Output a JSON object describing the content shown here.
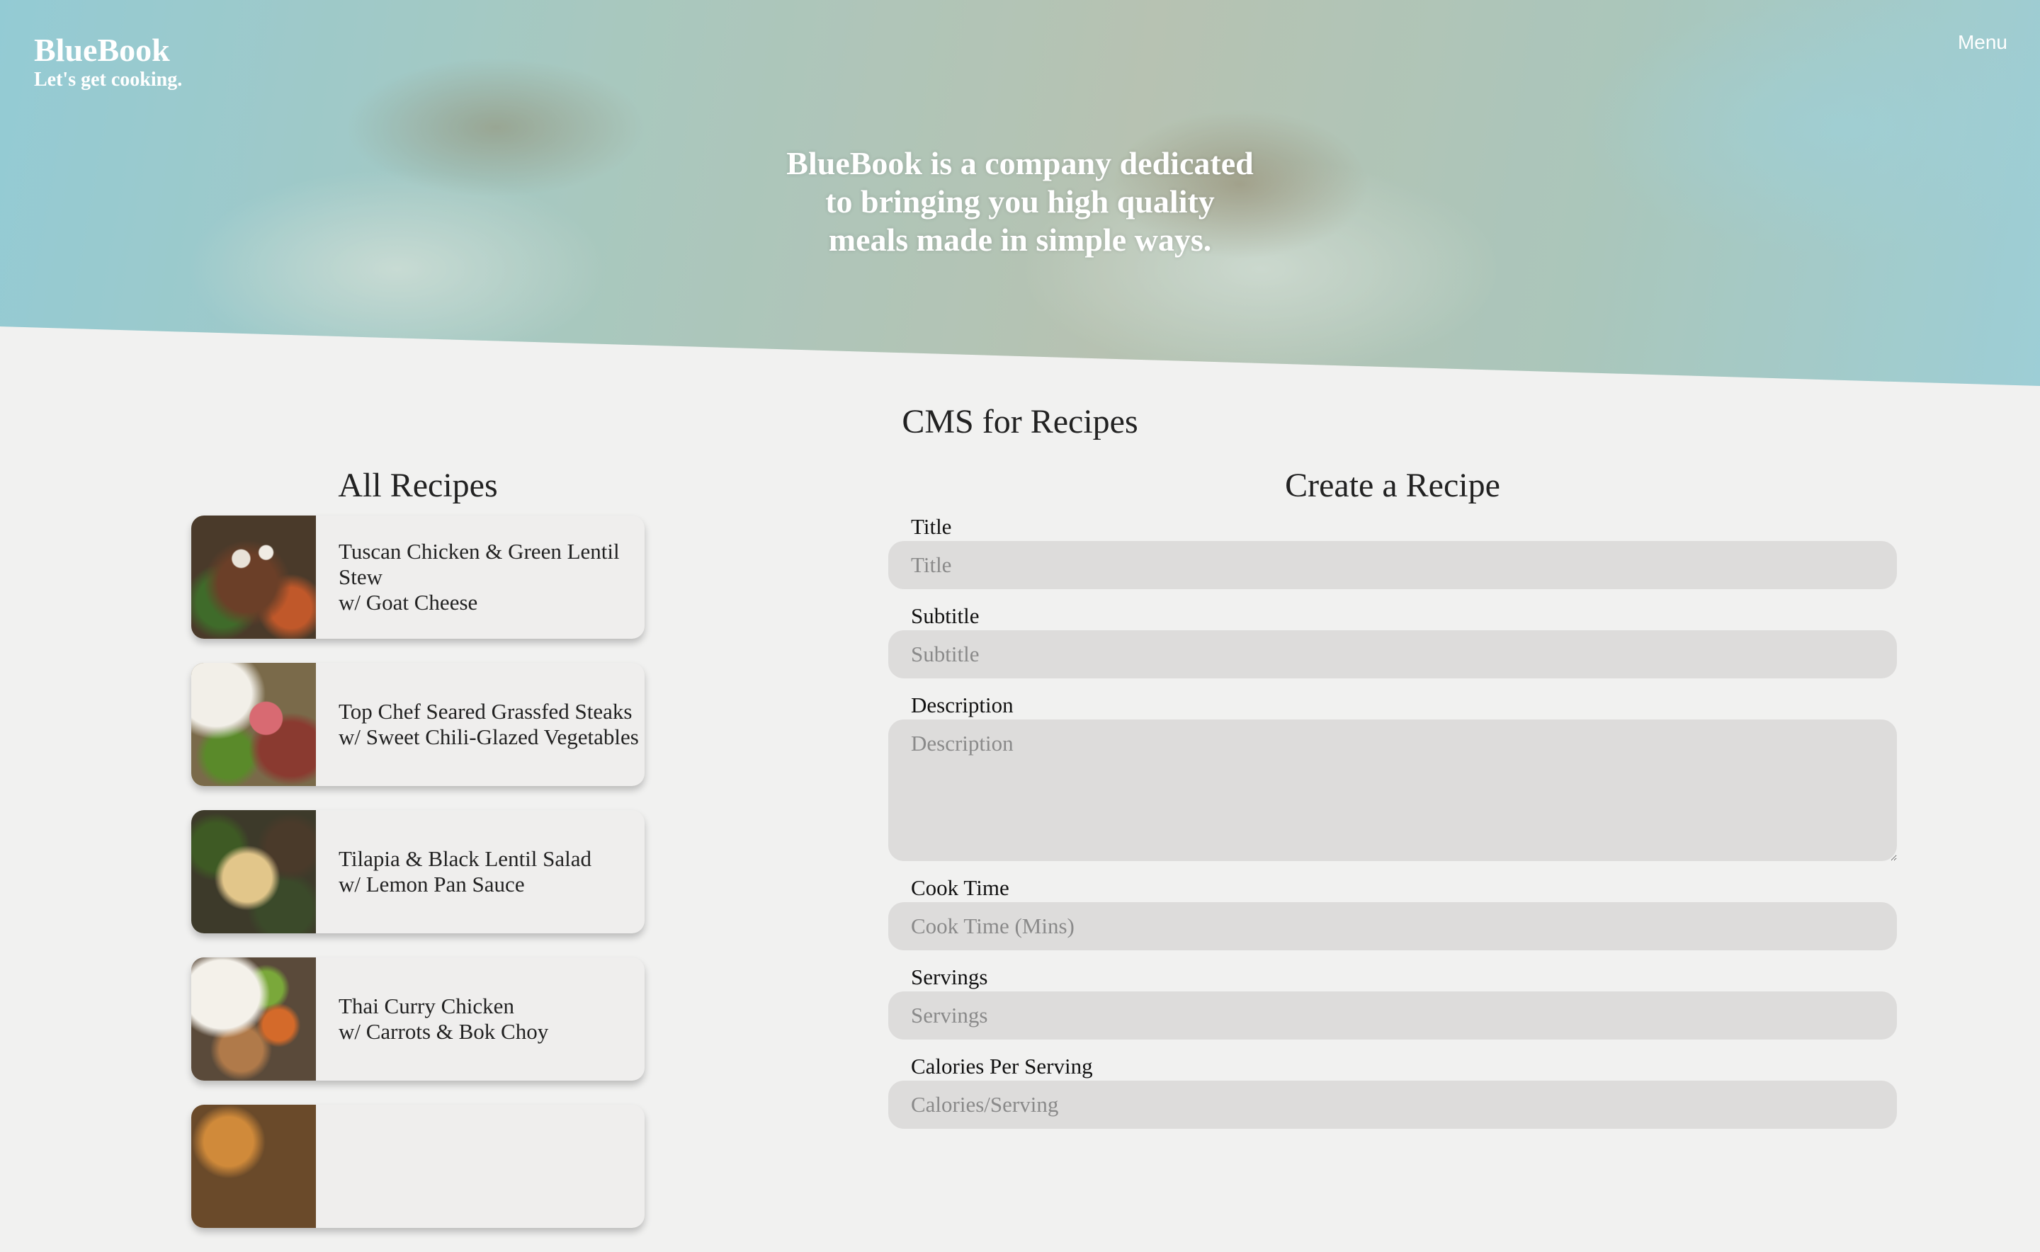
{
  "header": {
    "brand": "BlueBook",
    "tagline": "Let's get cooking.",
    "menu_label": "Menu",
    "hero_text": "BlueBook is a company dedicated to bringing you high quality meals made in simple ways."
  },
  "main": {
    "title": "CMS for Recipes"
  },
  "recipes": {
    "title": "All Recipes",
    "items": [
      {
        "line1": "Tuscan Chicken & Green Lentil Stew",
        "line2": "w/ Goat Cheese"
      },
      {
        "line1": "Top Chef Seared Grassfed Steaks",
        "line2": "w/ Sweet Chili-Glazed Vegetables"
      },
      {
        "line1": "Tilapia & Black Lentil Salad",
        "line2": "w/ Lemon Pan Sauce"
      },
      {
        "line1": "Thai Curry Chicken",
        "line2": "w/ Carrots & Bok Choy"
      }
    ]
  },
  "form": {
    "title": "Create a Recipe",
    "fields": [
      {
        "label": "Title",
        "placeholder": "Title"
      },
      {
        "label": "Subtitle",
        "placeholder": "Subtitle"
      },
      {
        "label": "Description",
        "placeholder": "Description"
      },
      {
        "label": "Cook Time",
        "placeholder": "Cook Time (Mins)"
      },
      {
        "label": "Servings",
        "placeholder": "Servings"
      },
      {
        "label": "Calories Per Serving",
        "placeholder": "Calories/Serving"
      }
    ]
  }
}
